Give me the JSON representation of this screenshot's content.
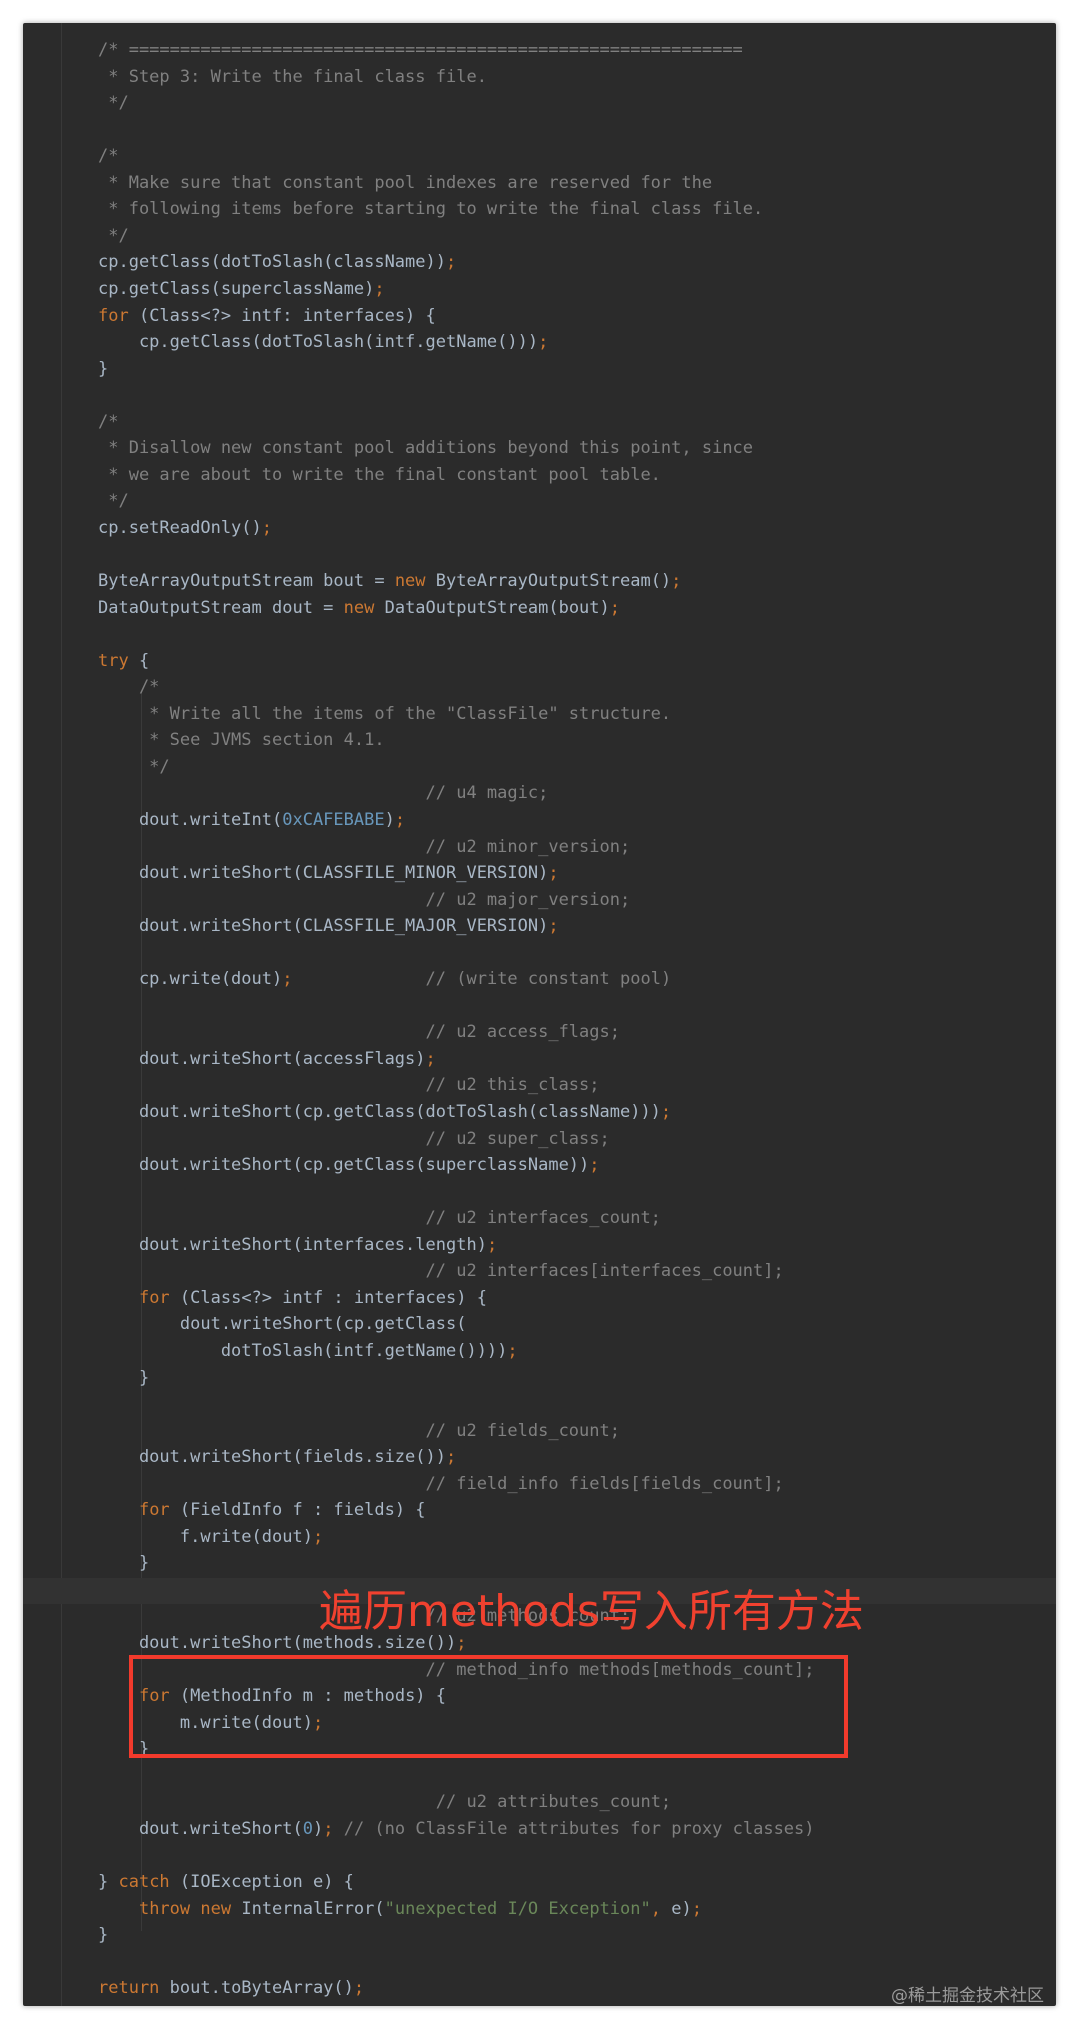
{
  "code_lines": [
    "/* ============================================================",
    " * Step 3: Write the final class file.",
    " */",
    "",
    "/*",
    " * Make sure that constant pool indexes are reserved for the",
    " * following items before starting to write the final class file.",
    " */",
    "cp.getClass(dotToSlash(className));",
    "cp.getClass(superclassName);",
    "for (Class<?> intf: interfaces) {",
    "    cp.getClass(dotToSlash(intf.getName()));",
    "}",
    "",
    "/*",
    " * Disallow new constant pool additions beyond this point, since",
    " * we are about to write the final constant pool table.",
    " */",
    "cp.setReadOnly();",
    "",
    "ByteArrayOutputStream bout = new ByteArrayOutputStream();",
    "DataOutputStream dout = new DataOutputStream(bout);",
    "",
    "try {",
    "    /*",
    "     * Write all the items of the \"ClassFile\" structure.",
    "     * See JVMS section 4.1.",
    "     */",
    "                                // u4 magic;",
    "    dout.writeInt(0xCAFEBABE);",
    "                                // u2 minor_version;",
    "    dout.writeShort(CLASSFILE_MINOR_VERSION);",
    "                                // u2 major_version;",
    "    dout.writeShort(CLASSFILE_MAJOR_VERSION);",
    "",
    "    cp.write(dout);             // (write constant pool)",
    "",
    "                                // u2 access_flags;",
    "    dout.writeShort(accessFlags);",
    "                                // u2 this_class;",
    "    dout.writeShort(cp.getClass(dotToSlash(className)));",
    "                                // u2 super_class;",
    "    dout.writeShort(cp.getClass(superclassName));",
    "",
    "                                // u2 interfaces_count;",
    "    dout.writeShort(interfaces.length);",
    "                                // u2 interfaces[interfaces_count];",
    "    for (Class<?> intf : interfaces) {",
    "        dout.writeShort(cp.getClass(",
    "            dotToSlash(intf.getName())));",
    "    }",
    "",
    "                                // u2 fields_count;",
    "    dout.writeShort(fields.size());",
    "                                // field_info fields[fields_count];",
    "    for (FieldInfo f : fields) {",
    "        f.write(dout);",
    "    }",
    "",
    "                                // u2 methods_count;",
    "    dout.writeShort(methods.size());",
    "                                // method_info methods[methods_count];",
    "    for (MethodInfo m : methods) {",
    "        m.write(dout);",
    "    }",
    "",
    "                                 // u2 attributes_count;",
    "    dout.writeShort(0); // (no ClassFile attributes for proxy classes)",
    "",
    "} catch (IOException e) {",
    "    throw new InternalError(\"unexpected I/O Exception\", e);",
    "}",
    "",
    "return bout.toByteArray();"
  ],
  "annotation": {
    "text": "遍历methods写入所有方法",
    "color": "#f23a2c"
  },
  "watermark": "@稀土掘金技术社区",
  "colors": {
    "background": "#2b2b2b",
    "keyword": "#cc7832",
    "number": "#6897bb",
    "string": "#6a8759",
    "comment": "#808080",
    "text": "#a9b7c6"
  }
}
